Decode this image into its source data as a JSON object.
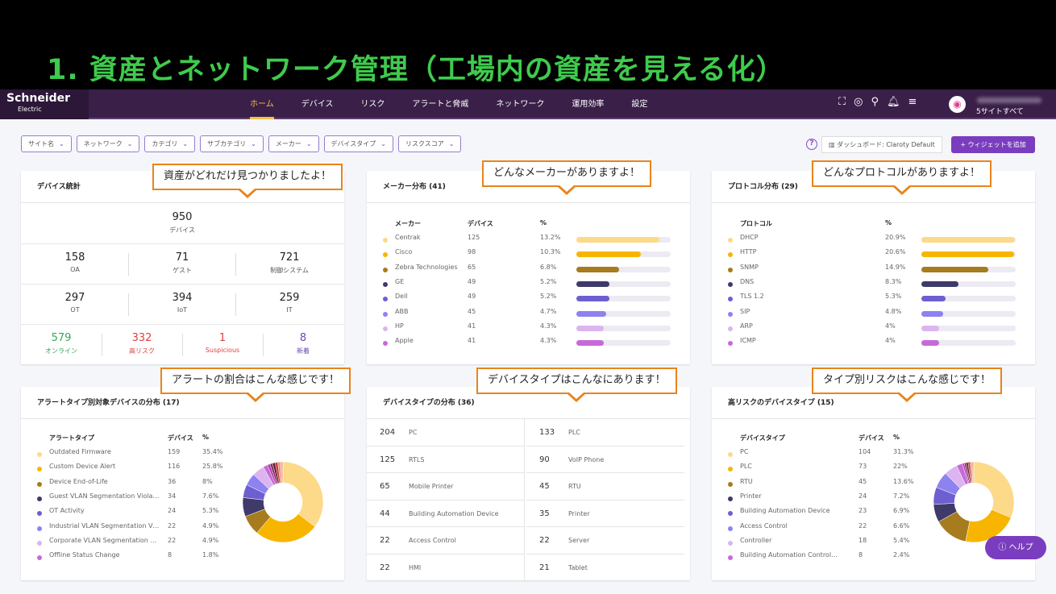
{
  "banner": {
    "title": "1. 資産とネットワーク管理（工場内の資産を見える化）"
  },
  "nav": {
    "logo_line1": "Schneider",
    "logo_line2": "Electric",
    "tabs": [
      "ホーム",
      "デバイス",
      "リスク",
      "アラートと脅威",
      "ネットワーク",
      "運用効率",
      "設定"
    ],
    "active_tab": 0,
    "icons": [
      "camera-scan-icon",
      "support-icon",
      "search-icon",
      "bell-icon",
      "filter-icon"
    ],
    "sites": "5サイトすべて"
  },
  "filters": [
    "サイト名",
    "ネットワーク",
    "カテゴリ",
    "サブカテゴリ",
    "メーカー",
    "デバイスタイプ",
    "リスクスコア"
  ],
  "toolbar": {
    "dashboard": "ダッシュボード: Claroty Default",
    "add_widget": "+ ウィジェットを追加",
    "help": "ヘルプ"
  },
  "colors": {
    "c1": "#fdd98a",
    "c2": "#f7b500",
    "c3": "#a67c1f",
    "c4": "#3f3a6a",
    "c5": "#6d5fd0",
    "c6": "#8c82f0",
    "c7": "#dcb4f0",
    "c8": "#c66ad9",
    "accent": "#7b3dbf",
    "callout": "#e8841b"
  },
  "callouts": [
    "資産がどれだけ見つかりましたよ！",
    "どんなメーカーがありますよ！",
    "どんなプロトコルがありますよ！",
    "アラートの割合はこんな感じです！",
    "デバイスタイプはこんなにあります！",
    "タイプ別リスクはこんな感じです！"
  ],
  "device_stats": {
    "title": "デバイス統計",
    "total": {
      "n": "950",
      "l": "デバイス"
    },
    "row1": [
      {
        "n": "158",
        "l": "OA"
      },
      {
        "n": "71",
        "l": "ゲスト"
      },
      {
        "n": "721",
        "l": "制御システム"
      }
    ],
    "row2": [
      {
        "n": "297",
        "l": "OT"
      },
      {
        "n": "394",
        "l": "IoT"
      },
      {
        "n": "259",
        "l": "IT"
      }
    ],
    "row3": [
      {
        "n": "579",
        "l": "オンライン",
        "c": "#3aa655"
      },
      {
        "n": "332",
        "l": "高リスク",
        "c": "#e04040"
      },
      {
        "n": "1",
        "l": "Suspicious",
        "c": "#e04040"
      },
      {
        "n": "8",
        "l": "新着",
        "c": "#6a4bb0"
      }
    ]
  },
  "vendors": {
    "title": "メーカー分布 (41)",
    "headers": [
      "メーカー",
      "デバイス",
      "%"
    ],
    "rows": [
      [
        "Centrak",
        "125",
        "13.2%",
        13.2
      ],
      [
        "Cisco",
        "98",
        "10.3%",
        10.3
      ],
      [
        "Zebra Technologies",
        "65",
        "6.8%",
        6.8
      ],
      [
        "GE",
        "49",
        "5.2%",
        5.2
      ],
      [
        "Dell",
        "49",
        "5.2%",
        5.2
      ],
      [
        "ABB",
        "45",
        "4.7%",
        4.7
      ],
      [
        "HP",
        "41",
        "4.3%",
        4.3
      ],
      [
        "Apple",
        "41",
        "4.3%",
        4.3
      ]
    ]
  },
  "protocols": {
    "title": "プロトコル分布 (29)",
    "headers": [
      "プロトコル",
      "%"
    ],
    "rows": [
      [
        "DHCP",
        "20.9%",
        20.9
      ],
      [
        "HTTP",
        "20.6%",
        20.6
      ],
      [
        "SNMP",
        "14.9%",
        14.9
      ],
      [
        "DNS",
        "8.3%",
        8.3
      ],
      [
        "TLS 1.2",
        "5.3%",
        5.3
      ],
      [
        "SIP",
        "4.8%",
        4.8
      ],
      [
        "ARP",
        "4%",
        4
      ],
      [
        "ICMP",
        "4%",
        4
      ]
    ]
  },
  "alerts": {
    "title": "アラートタイプ別対象デバイスの分布 (17)",
    "headers": [
      "アラートタイプ",
      "デバイス",
      "%"
    ],
    "rows": [
      [
        "Outdated Firmware",
        "159",
        "35.4%",
        35.4
      ],
      [
        "Custom Device Alert",
        "116",
        "25.8%",
        25.8
      ],
      [
        "Device End-of-Life",
        "36",
        "8%",
        8
      ],
      [
        "Guest VLAN Segmentation Viola…",
        "34",
        "7.6%",
        7.6
      ],
      [
        "OT Activity",
        "24",
        "5.3%",
        5.3
      ],
      [
        "Industrial VLAN Segmentation V…",
        "22",
        "4.9%",
        4.9
      ],
      [
        "Corporate VLAN Segmentation …",
        "22",
        "4.9%",
        4.9
      ],
      [
        "Offline Status Change",
        "8",
        "1.8%",
        1.8
      ]
    ]
  },
  "device_types": {
    "title": "デバイスタイプの分布 (36)",
    "left": [
      [
        "204",
        "PC"
      ],
      [
        "125",
        "RTLS"
      ],
      [
        "65",
        "Mobile Printer"
      ],
      [
        "44",
        "Building Automation Device"
      ],
      [
        "22",
        "Access Control"
      ],
      [
        "22",
        "HMI"
      ]
    ],
    "right": [
      [
        "133",
        "PLC"
      ],
      [
        "90",
        "VoIP Phone"
      ],
      [
        "45",
        "RTU"
      ],
      [
        "35",
        "Printer"
      ],
      [
        "22",
        "Server"
      ],
      [
        "21",
        "Tablet"
      ]
    ]
  },
  "high_risk": {
    "title": "高リスクのデバイスタイプ (15)",
    "headers": [
      "デバイスタイプ",
      "デバイス",
      "%"
    ],
    "rows": [
      [
        "PC",
        "104",
        "31.3%",
        31.3
      ],
      [
        "PLC",
        "73",
        "22%",
        22
      ],
      [
        "RTU",
        "45",
        "13.6%",
        13.6
      ],
      [
        "Printer",
        "24",
        "7.2%",
        7.2
      ],
      [
        "Building Automation Device",
        "23",
        "6.9%",
        6.9
      ],
      [
        "Access Control",
        "22",
        "6.6%",
        6.6
      ],
      [
        "Controller",
        "18",
        "5.4%",
        5.4
      ],
      [
        "Building Automation Control…",
        "8",
        "2.4%",
        2.4
      ]
    ]
  }
}
